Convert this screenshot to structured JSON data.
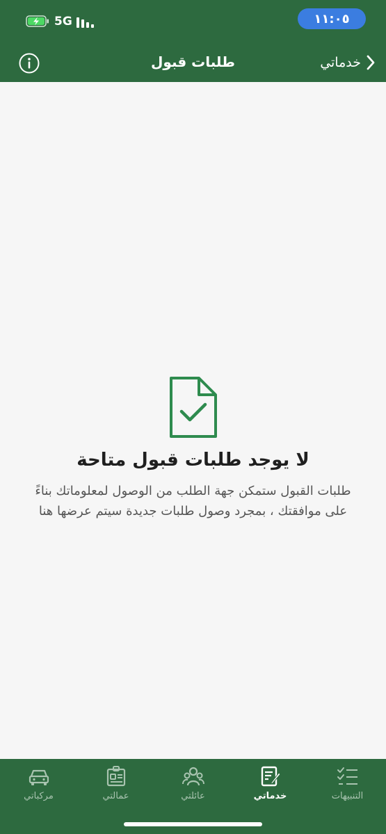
{
  "status_bar": {
    "time": "١١:٠٥",
    "network": "5G",
    "battery_icon": "battery-charging-icon",
    "signal_icon": "signal-bars-icon"
  },
  "header": {
    "title": "طلبات قبول",
    "back_label": "خدماتي",
    "info_icon": "info-circle-icon",
    "back_icon": "chevron-right-icon"
  },
  "empty_state": {
    "icon": "document-check-icon",
    "title": "لا يوجد طلبات قبول متاحة",
    "message": "طلبات القبول ستمكن جهة الطلب من الوصول لمعلوماتك بناءً على موافقتك ، بمجرد وصول طلبات جديدة سيتم عرضها هنا"
  },
  "bottom_nav": {
    "active": "خدماتي",
    "items": [
      {
        "label": "مركباتي",
        "icon": "car-icon"
      },
      {
        "label": "عمالتي",
        "icon": "id-card-icon"
      },
      {
        "label": "عائلتي",
        "icon": "family-icon"
      },
      {
        "label": "خدماتي",
        "icon": "services-document-icon"
      },
      {
        "label": "التنبيهات",
        "icon": "checklist-icon"
      }
    ]
  },
  "colors": {
    "brand_green": "#2d6a3f",
    "time_pill_blue": "#3b7de0",
    "icon_green": "#2e8b4e",
    "background": "#f6f6f6"
  }
}
